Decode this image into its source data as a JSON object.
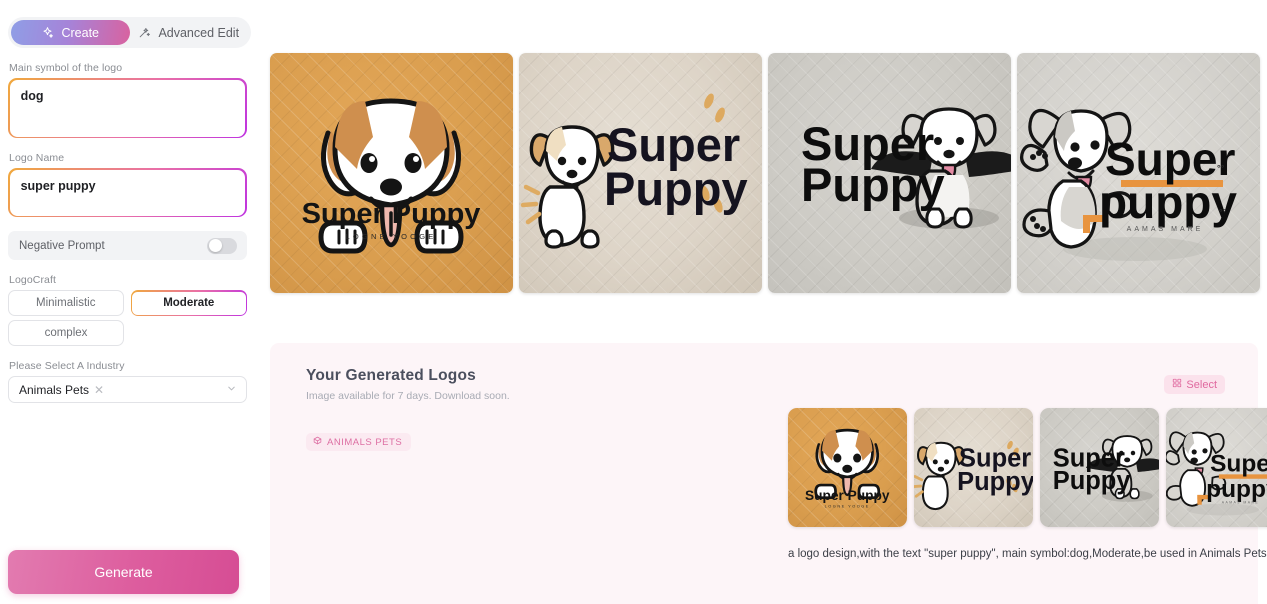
{
  "tabs": [
    {
      "label": "Create",
      "icon": "sparkle-icon",
      "active": true
    },
    {
      "label": "Advanced Edit",
      "icon": "magic-wand-icon",
      "active": false
    }
  ],
  "form": {
    "main_symbol": {
      "label": "Main symbol of the logo",
      "value": "dog",
      "placeholder": ""
    },
    "logo_name": {
      "label": "Logo Name",
      "value": "super puppy",
      "placeholder": ""
    },
    "negative_prompt": {
      "label": "Negative Prompt",
      "enabled": false
    },
    "logocraft": {
      "label": "LogoCraft",
      "options": [
        "Minimalistic",
        "Moderate",
        "complex"
      ],
      "selected": "Moderate"
    },
    "industry": {
      "label": "Please Select A Industry",
      "value": "Animals Pets",
      "remove_icon": "close-icon",
      "chevron_icon": "chevron-down-icon"
    },
    "generate_label": "Generate"
  },
  "results": {
    "title": "Your Generated Logos",
    "subtitle": "Image available for 7 days. Download soon.",
    "select_label": "Select",
    "select_icon": "selection-grid-icon",
    "tag": {
      "label": "ANIMALS PETS",
      "icon": "box-icon"
    },
    "caption": "a logo design,with the text \"super puppy\", main symbol:dog,Moderate,be used in Animals Pets industry,clear background"
  },
  "logos": [
    {
      "id": "logo-1",
      "style": "bg-tan",
      "title": "Super Puppy",
      "tagline": "LOGNE YOOGE"
    },
    {
      "id": "logo-2",
      "style": "bg-beige",
      "title": "Super Puppy",
      "tagline": ""
    },
    {
      "id": "logo-3",
      "style": "bg-gray1",
      "title": "Super Puppy",
      "tagline": ""
    },
    {
      "id": "logo-4",
      "style": "bg-gray2",
      "title": "Super puppy",
      "tagline": "AAMAS MARE"
    }
  ],
  "colors": {
    "accent_pink": "#dd5d9e",
    "gradient_start": "#f0a93c",
    "gradient_end": "#bf33e0",
    "panel_bg": "#fdf5f8",
    "tan": "#d99d4e",
    "orange_accent": "#e8943f"
  }
}
